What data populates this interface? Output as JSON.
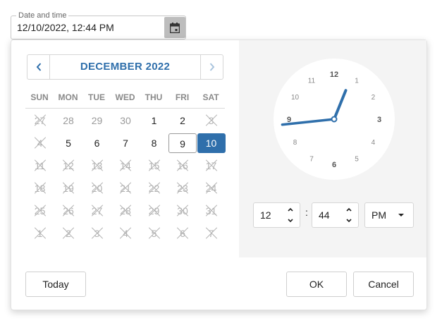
{
  "field": {
    "label": "Date and time",
    "value": "12/10/2022, 12:44 PM",
    "calendar_button_icon": "calendar-icon"
  },
  "calendar": {
    "month_title": "DECEMBER 2022",
    "prev_icon": "chevron-left-icon",
    "next_icon": "chevron-right-icon",
    "weekdays": [
      "SUN",
      "MON",
      "TUE",
      "WED",
      "THU",
      "FRI",
      "SAT"
    ],
    "days": [
      {
        "label": "27",
        "state": "disabled"
      },
      {
        "label": "28",
        "state": "muted"
      },
      {
        "label": "29",
        "state": "muted"
      },
      {
        "label": "30",
        "state": "muted"
      },
      {
        "label": "1",
        "state": "normal"
      },
      {
        "label": "2",
        "state": "normal"
      },
      {
        "label": "3",
        "state": "disabled"
      },
      {
        "label": "4",
        "state": "disabled"
      },
      {
        "label": "5",
        "state": "normal"
      },
      {
        "label": "6",
        "state": "normal"
      },
      {
        "label": "7",
        "state": "normal"
      },
      {
        "label": "8",
        "state": "normal"
      },
      {
        "label": "9",
        "state": "today"
      },
      {
        "label": "10",
        "state": "selected"
      },
      {
        "label": "11",
        "state": "disabled"
      },
      {
        "label": "12",
        "state": "disabled"
      },
      {
        "label": "13",
        "state": "disabled"
      },
      {
        "label": "14",
        "state": "disabled"
      },
      {
        "label": "15",
        "state": "disabled"
      },
      {
        "label": "16",
        "state": "disabled"
      },
      {
        "label": "17",
        "state": "disabled"
      },
      {
        "label": "18",
        "state": "disabled"
      },
      {
        "label": "19",
        "state": "disabled"
      },
      {
        "label": "20",
        "state": "disabled"
      },
      {
        "label": "21",
        "state": "disabled"
      },
      {
        "label": "22",
        "state": "disabled"
      },
      {
        "label": "23",
        "state": "disabled"
      },
      {
        "label": "24",
        "state": "disabled"
      },
      {
        "label": "25",
        "state": "disabled"
      },
      {
        "label": "26",
        "state": "disabled"
      },
      {
        "label": "27",
        "state": "disabled"
      },
      {
        "label": "28",
        "state": "disabled"
      },
      {
        "label": "29",
        "state": "disabled"
      },
      {
        "label": "30",
        "state": "disabled"
      },
      {
        "label": "31",
        "state": "disabled"
      },
      {
        "label": "1",
        "state": "disabled"
      },
      {
        "label": "2",
        "state": "disabled"
      },
      {
        "label": "3",
        "state": "disabled"
      },
      {
        "label": "4",
        "state": "disabled"
      },
      {
        "label": "5",
        "state": "disabled"
      },
      {
        "label": "6",
        "state": "disabled"
      },
      {
        "label": "7",
        "state": "disabled"
      }
    ]
  },
  "clock": {
    "numbers": [
      "12",
      "1",
      "2",
      "3",
      "4",
      "5",
      "6",
      "7",
      "8",
      "9",
      "10",
      "11"
    ],
    "hour": 12,
    "minute": 44,
    "hand_color": "#2f6fab"
  },
  "time": {
    "hour": "12",
    "separator": ":",
    "minute": "44",
    "period": "PM",
    "up_icon": "chevron-up-icon",
    "down_icon": "chevron-down-icon",
    "dropdown_icon": "caret-down-icon"
  },
  "actions": {
    "today_label": "Today",
    "ok_label": "OK",
    "cancel_label": "Cancel"
  },
  "colors": {
    "accent": "#2f6fab",
    "clock_bg": "#f4f4f4"
  }
}
